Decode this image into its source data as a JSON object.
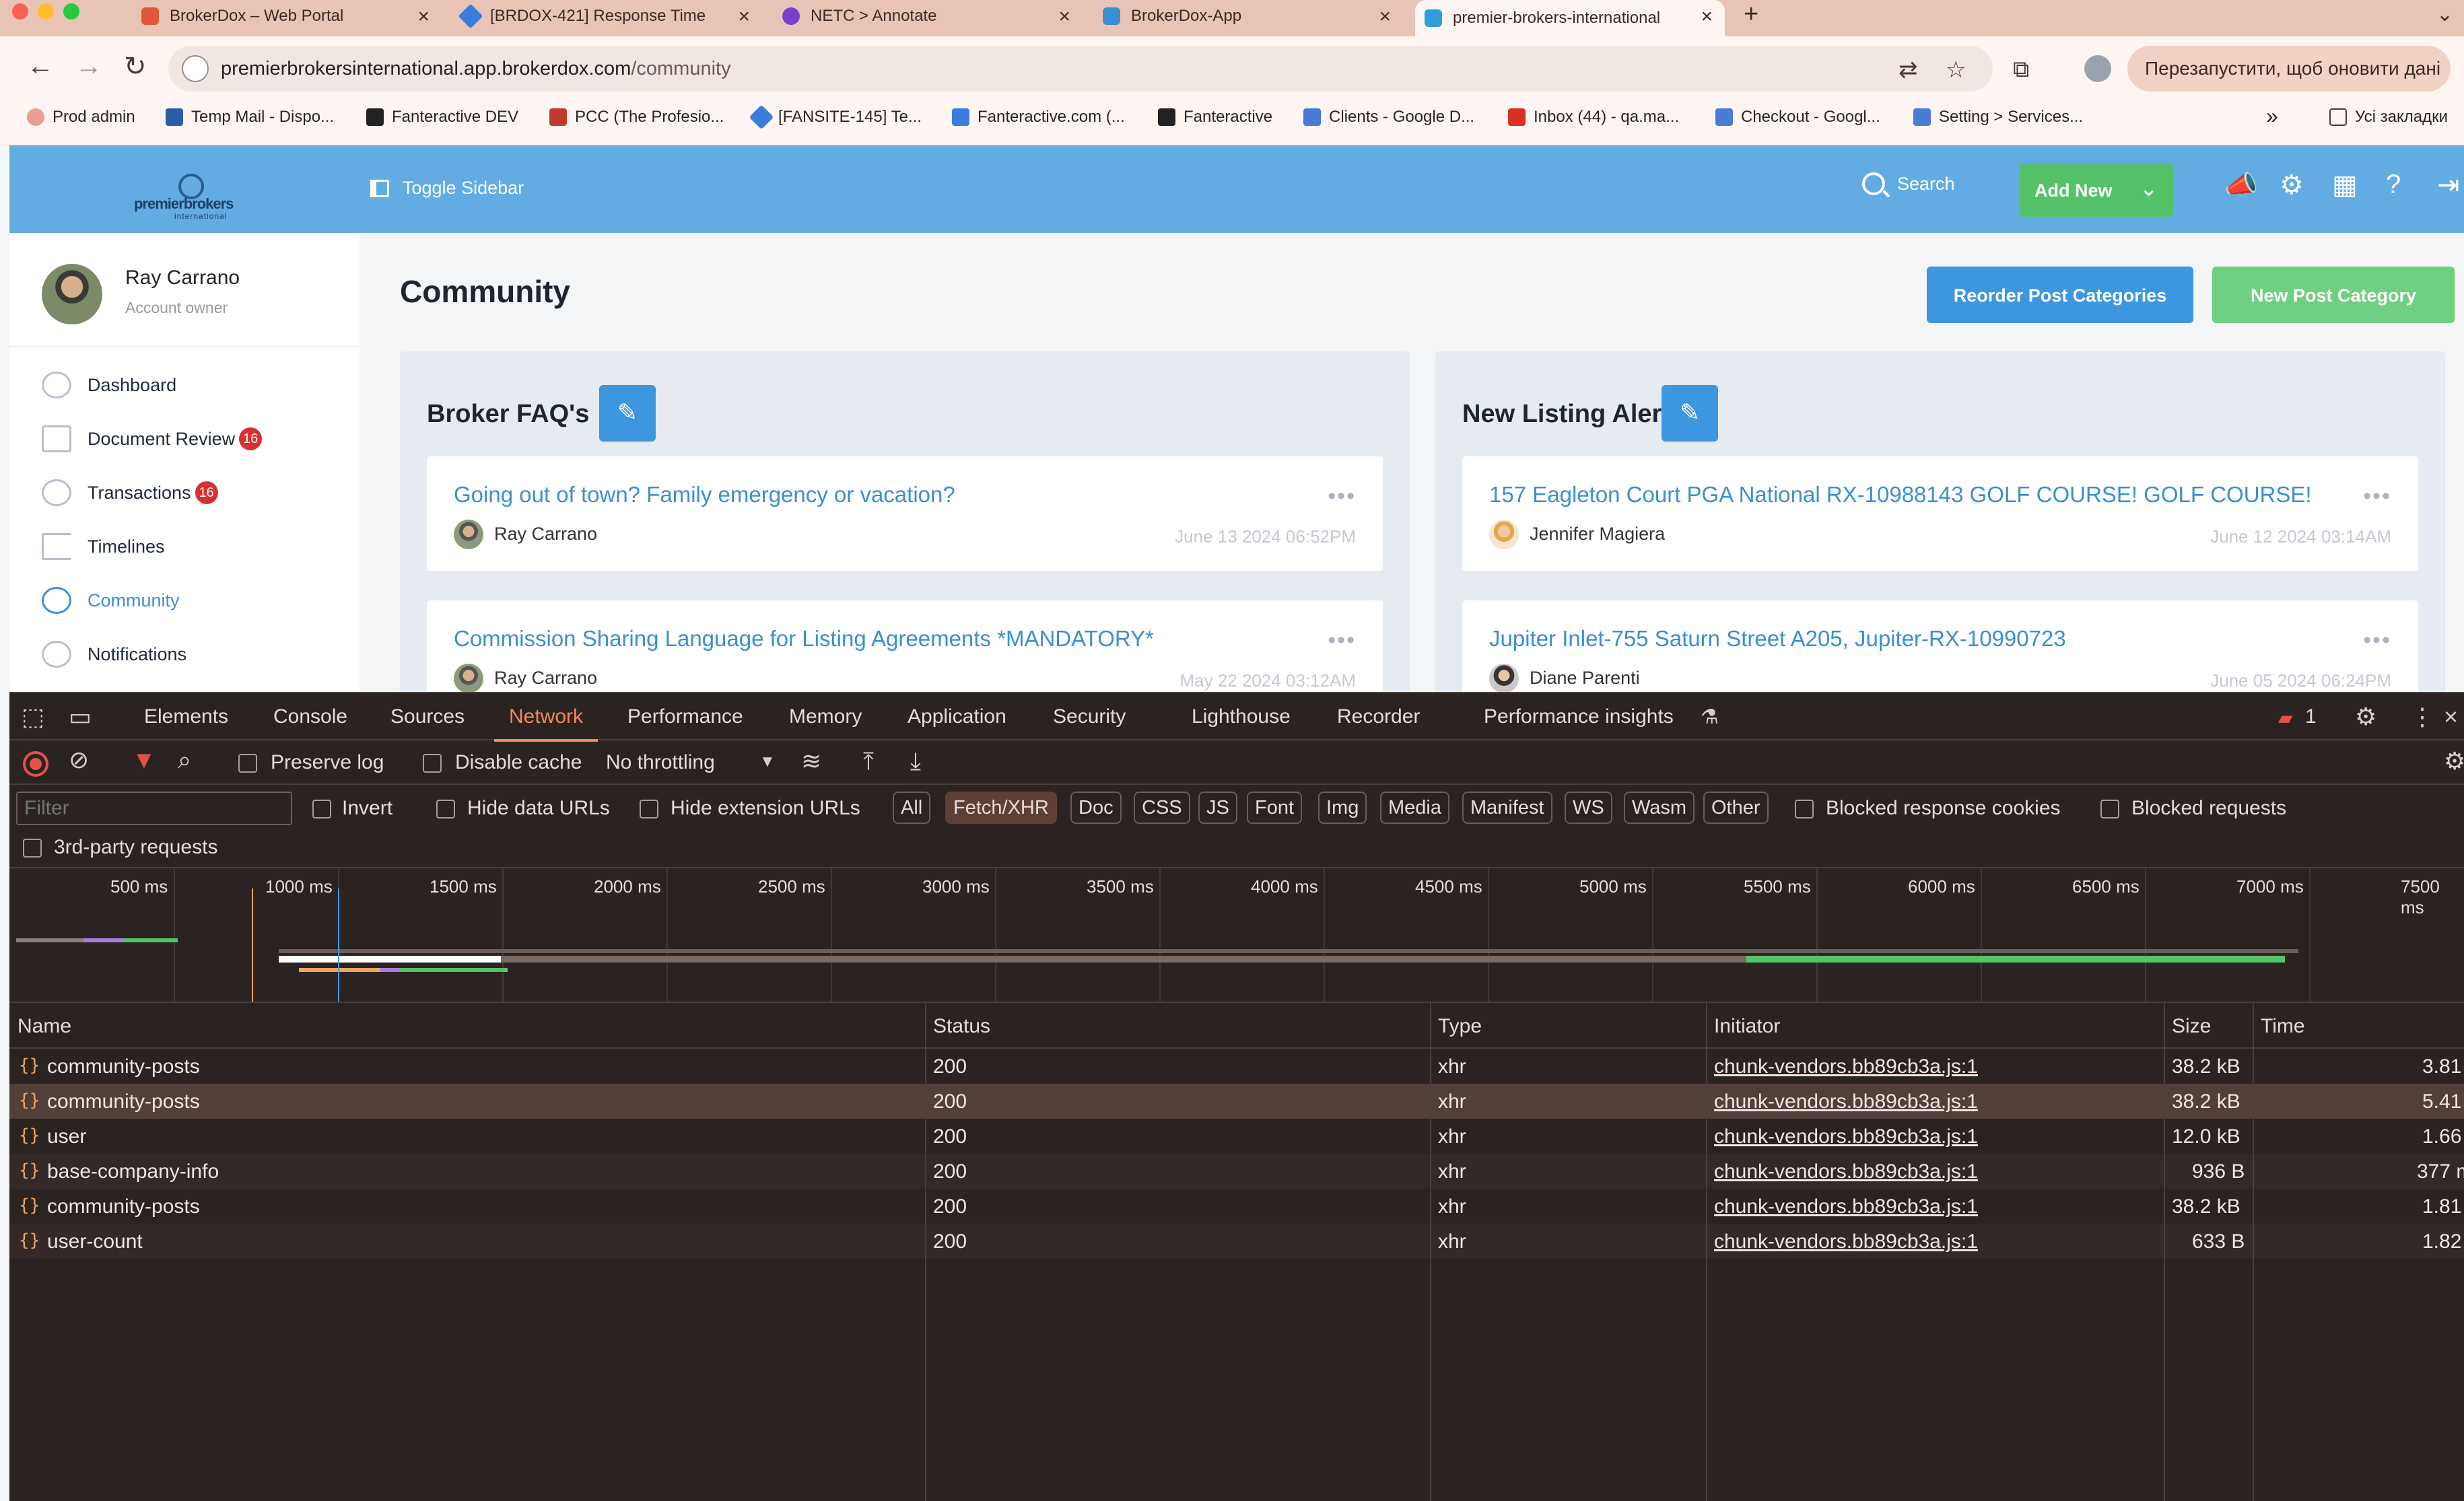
{
  "browser": {
    "tabs": [
      {
        "title": "BrokerDox – Web Portal",
        "favicon_color": "#e0573a"
      },
      {
        "title": "[BRDOX-421] Response Time",
        "favicon_color": "#3b7ddd"
      },
      {
        "title": "NETC > Annotate",
        "favicon_color": "#7b3fd0"
      },
      {
        "title": "BrokerDox-App",
        "favicon_color": "#3a8fd4"
      },
      {
        "title": "premier-brokers-international",
        "favicon_color": "#2f9fd8"
      }
    ],
    "new_tab_glyph": "+",
    "url_host": "premierbrokersinternational.app.brokerdox.com",
    "url_path": "/community",
    "update_button": "Перезапустити, щоб оновити дані",
    "bookmarks": [
      {
        "label": "Prod admin",
        "icon_color": "#e8a090"
      },
      {
        "label": "Temp Mail - Dispo...",
        "icon_color": "#2a5caa"
      },
      {
        "label": "Fanteractive DEV",
        "icon_color": "#222222"
      },
      {
        "label": "PCC (The Profesio...",
        "icon_color": "#c0392b"
      },
      {
        "label": "[FANSITE-145] Te...",
        "icon_color": "#3b7ddd"
      },
      {
        "label": "Fanteractive.com (...",
        "icon_color": "#3b7ddd"
      },
      {
        "label": "Fanteractive",
        "icon_color": "#222222"
      },
      {
        "label": "Clients - Google D...",
        "icon_color": "#4a7bd8"
      },
      {
        "label": "Inbox (44) - qa.ma...",
        "icon_color": "#d93025"
      },
      {
        "label": "Checkout - Googl...",
        "icon_color": "#4a7bd8"
      },
      {
        "label": "Setting > Services...",
        "icon_color": "#4a7bd8"
      }
    ],
    "bookmarks_overflow": "»",
    "all_bookmarks": "Усі закладки"
  },
  "app": {
    "logo_word": "premierbrokers",
    "logo_sub": "international",
    "toggle_sidebar": "Toggle Sidebar",
    "search": "Search",
    "add_new": "Add New",
    "user": {
      "name": "Ray Carrano",
      "role": "Account owner"
    },
    "nav": [
      {
        "label": "Dashboard",
        "badge": ""
      },
      {
        "label": "Document Review",
        "badge": "16"
      },
      {
        "label": "Transactions",
        "badge": "16"
      },
      {
        "label": "Timelines",
        "badge": ""
      },
      {
        "label": "Community",
        "badge": ""
      },
      {
        "label": "Notifications",
        "badge": ""
      }
    ],
    "page_title": "Community",
    "reorder_button": "Reorder Post Categories",
    "new_category_button": "New Post Category",
    "categories": [
      {
        "title": "Broker FAQ's",
        "posts": [
          {
            "title": "Going out of town? Family emergency or vacation?",
            "author": "Ray Carrano",
            "date": "June 13 2024 06:52PM"
          },
          {
            "title": "Commission Sharing Language for Listing Agreements *MANDATORY*",
            "author": "Ray Carrano",
            "date": "May 22 2024 03:12AM"
          }
        ]
      },
      {
        "title": "New Listing Alert",
        "posts": [
          {
            "title": "157 Eagleton Court PGA National RX-10988143 GOLF COURSE! GOLF COURSE!",
            "author": "Jennifer Magiera",
            "date": "June 12 2024 03:14AM"
          },
          {
            "title": "Jupiter Inlet-755 Saturn Street A205, Jupiter-RX-10990723",
            "author": "Diane Parenti",
            "date": "June 05 2024 06:24PM"
          }
        ]
      }
    ]
  },
  "devtools": {
    "tabs": [
      "Elements",
      "Console",
      "Sources",
      "Network",
      "Performance",
      "Memory",
      "Application",
      "Security",
      "Lighthouse",
      "Recorder",
      "Performance insights"
    ],
    "active_tab": "Network",
    "issues_count": "1",
    "preserve_log": "Preserve log",
    "disable_cache": "Disable cache",
    "throttling": "No throttling",
    "filter_placeholder": "Filter",
    "invert": "Invert",
    "hide_data_urls": "Hide data URLs",
    "hide_extension_urls": "Hide extension URLs",
    "type_filters": [
      "All",
      "Fetch/XHR",
      "Doc",
      "CSS",
      "JS",
      "Font",
      "Img",
      "Media",
      "Manifest",
      "WS",
      "Wasm",
      "Other"
    ],
    "active_type_filter": "Fetch/XHR",
    "blocked_response_cookies": "Blocked response cookies",
    "blocked_requests": "Blocked requests",
    "third_party": "3rd-party requests",
    "timeline_labels": [
      "500 ms",
      "1000 ms",
      "1500 ms",
      "2000 ms",
      "2500 ms",
      "3000 ms",
      "3500 ms",
      "4000 ms",
      "4500 ms",
      "5000 ms",
      "5500 ms",
      "6000 ms",
      "6500 ms",
      "7000 ms",
      "7500 ms"
    ],
    "columns": [
      "Name",
      "Status",
      "Type",
      "Initiator",
      "Size",
      "Time"
    ],
    "requests": [
      {
        "name": "community-posts",
        "status": "200",
        "type": "xhr",
        "initiator": "chunk-vendors.bb89cb3a.js:1",
        "size": "38.2 kB",
        "time": "3.81"
      },
      {
        "name": "community-posts",
        "status": "200",
        "type": "xhr",
        "initiator": "chunk-vendors.bb89cb3a.js:1",
        "size": "38.2 kB",
        "time": "5.41"
      },
      {
        "name": "user",
        "status": "200",
        "type": "xhr",
        "initiator": "chunk-vendors.bb89cb3a.js:1",
        "size": "12.0 kB",
        "time": "1.66"
      },
      {
        "name": "base-company-info",
        "status": "200",
        "type": "xhr",
        "initiator": "chunk-vendors.bb89cb3a.js:1",
        "size": "936 B",
        "time": "377 m"
      },
      {
        "name": "community-posts",
        "status": "200",
        "type": "xhr",
        "initiator": "chunk-vendors.bb89cb3a.js:1",
        "size": "38.2 kB",
        "time": "1.81"
      },
      {
        "name": "user-count",
        "status": "200",
        "type": "xhr",
        "initiator": "chunk-vendors.bb89cb3a.js:1",
        "size": "633 B",
        "time": "1.82"
      }
    ],
    "selected_row": 1
  }
}
